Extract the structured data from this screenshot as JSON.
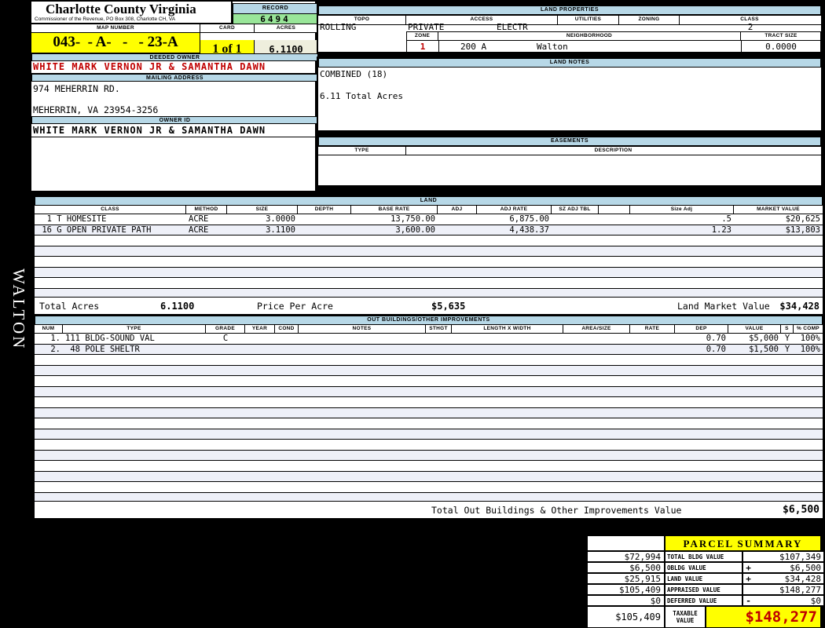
{
  "header": {
    "county": "Charlotte County Virginia",
    "commissioner": "Commissioner of the Revenue, PO  Box 308, Charlotte CH, VA",
    "record_label": "RECORD",
    "record_value": "6494",
    "map_number_label": "MAP NUMBER",
    "map_number": "043-  - A-   -   - 23-A",
    "card_label": "CARD",
    "card_value": "1 of 1",
    "acres_label": "ACRES",
    "acres_value": "6.1100"
  },
  "sidebar": {
    "vertical_text": "WALTON"
  },
  "owner": {
    "deeded_owner_label": "DEEDED OWNER",
    "deeded_owner": "WHITE MARK VERNON JR & SAMANTHA DAWN",
    "mailing_address_label": "MAILING ADDRESS",
    "address_line1": "974 MEHERRIN RD.",
    "address_line2": "MEHERRIN, VA 23954-3256",
    "owner_id_label": "OWNER ID",
    "owner_id": "WHITE MARK VERNON JR & SAMANTHA DAWN"
  },
  "land_properties": {
    "title": "LAND PROPERTIES",
    "headers": [
      "TOPO",
      "ACCESS",
      "UTILITIES",
      "ZONING",
      "CLASS"
    ],
    "topo": "ROLLING",
    "access": "PRIVATE",
    "utilities": "ELECTR",
    "zoning": "",
    "class": "2",
    "zone_label": "ZONE",
    "zone": "1",
    "neighborhood_label": "NEIGHBORHOOD",
    "neighborhood_code": "200 A",
    "neighborhood_name": "Walton",
    "tract_size_label": "TRACT SIZE",
    "tract_size": "0.0000"
  },
  "land_notes": {
    "title": "LAND NOTES",
    "line1": "COMBINED (18)",
    "line2": "6.11 Total Acres"
  },
  "easements": {
    "title": "EASEMENTS",
    "type_label": "TYPE",
    "description_label": "DESCRIPTION"
  },
  "land": {
    "title": "LAND",
    "headers": [
      "CLASS",
      "METHOD",
      "SIZE",
      "DEPTH",
      "BASE RATE",
      "ADJ",
      "ADJ RATE",
      "SZ ADJ TBL",
      "",
      "Size Adj",
      "MARKET VALUE"
    ],
    "rows": [
      [
        "  1 T HOMESITE",
        "ACRE",
        "3.0000",
        "",
        "13,750.00",
        "",
        "6,875.00",
        "",
        "",
        ".5",
        "$20,625"
      ],
      [
        " 16 G OPEN PRIVATE PATH",
        "ACRE",
        "3.1100",
        "",
        "3,600.00",
        "",
        "4,438.37",
        "",
        "",
        "1.23",
        "$13,803"
      ]
    ],
    "totals": {
      "total_acres_label": "Total Acres",
      "total_acres": "6.1100",
      "price_per_acre_label": "Price Per Acre",
      "price_per_acre": "$5,635",
      "land_market_value_label": "Land Market Value",
      "land_market_value": "$34,428"
    }
  },
  "out_buildings": {
    "title": "OUT BUILDINGS/OTHER IMPROVEMENTS",
    "headers": [
      "NUM",
      "TYPE",
      "GRADE",
      "YEAR",
      "COND",
      "NOTES",
      "STHGT",
      "LENGTH X WIDTH",
      "AREA/SIZE",
      "RATE",
      "DEP",
      "VALUE",
      "S",
      "% COMP"
    ],
    "rows": [
      [
        "1.",
        "111 BLDG-SOUND VAL",
        "C",
        "",
        "",
        "",
        "",
        "",
        "",
        "",
        "0.70",
        "$5,000",
        "Y",
        "100%"
      ],
      [
        "2.",
        " 48 POLE SHELTR",
        "",
        "",
        "",
        "",
        "",
        "",
        "",
        "",
        "0.70",
        "$1,500",
        "Y",
        "100%"
      ]
    ],
    "total_label": "Total Out Buildings & Other Improvements Value",
    "total_value": "$6,500"
  },
  "parcel_summary": {
    "title": "PARCEL SUMMARY",
    "rows": [
      {
        "prior": "$72,994",
        "label": "TOTAL BLDG VALUE",
        "op": "",
        "value": "$107,349"
      },
      {
        "prior": "$6,500",
        "label": "OBLDG VALUE",
        "op": "+",
        "value": "$6,500"
      },
      {
        "prior": "$25,915",
        "label": "LAND VALUE",
        "op": "+",
        "value": "$34,428"
      },
      {
        "prior": "$105,409",
        "label": "APPRAISED VALUE",
        "op": "",
        "value": "$148,277"
      },
      {
        "prior": "$0",
        "label": "DEFERRED VALUE",
        "op": "-",
        "value": "$0"
      }
    ],
    "taxable": {
      "prior": "$105,409",
      "label_line1": "TAXABLE",
      "label_line2": "VALUE",
      "value": "$148,277"
    }
  },
  "colors": {
    "highlight_yellow": "#ffff00",
    "record_green": "#99e699",
    "acres_beige": "#eeeedd",
    "section_blue": "#b7d8e7",
    "alert_red": "#c00000",
    "row_alt": "#eef0f8",
    "background": "#000000"
  }
}
